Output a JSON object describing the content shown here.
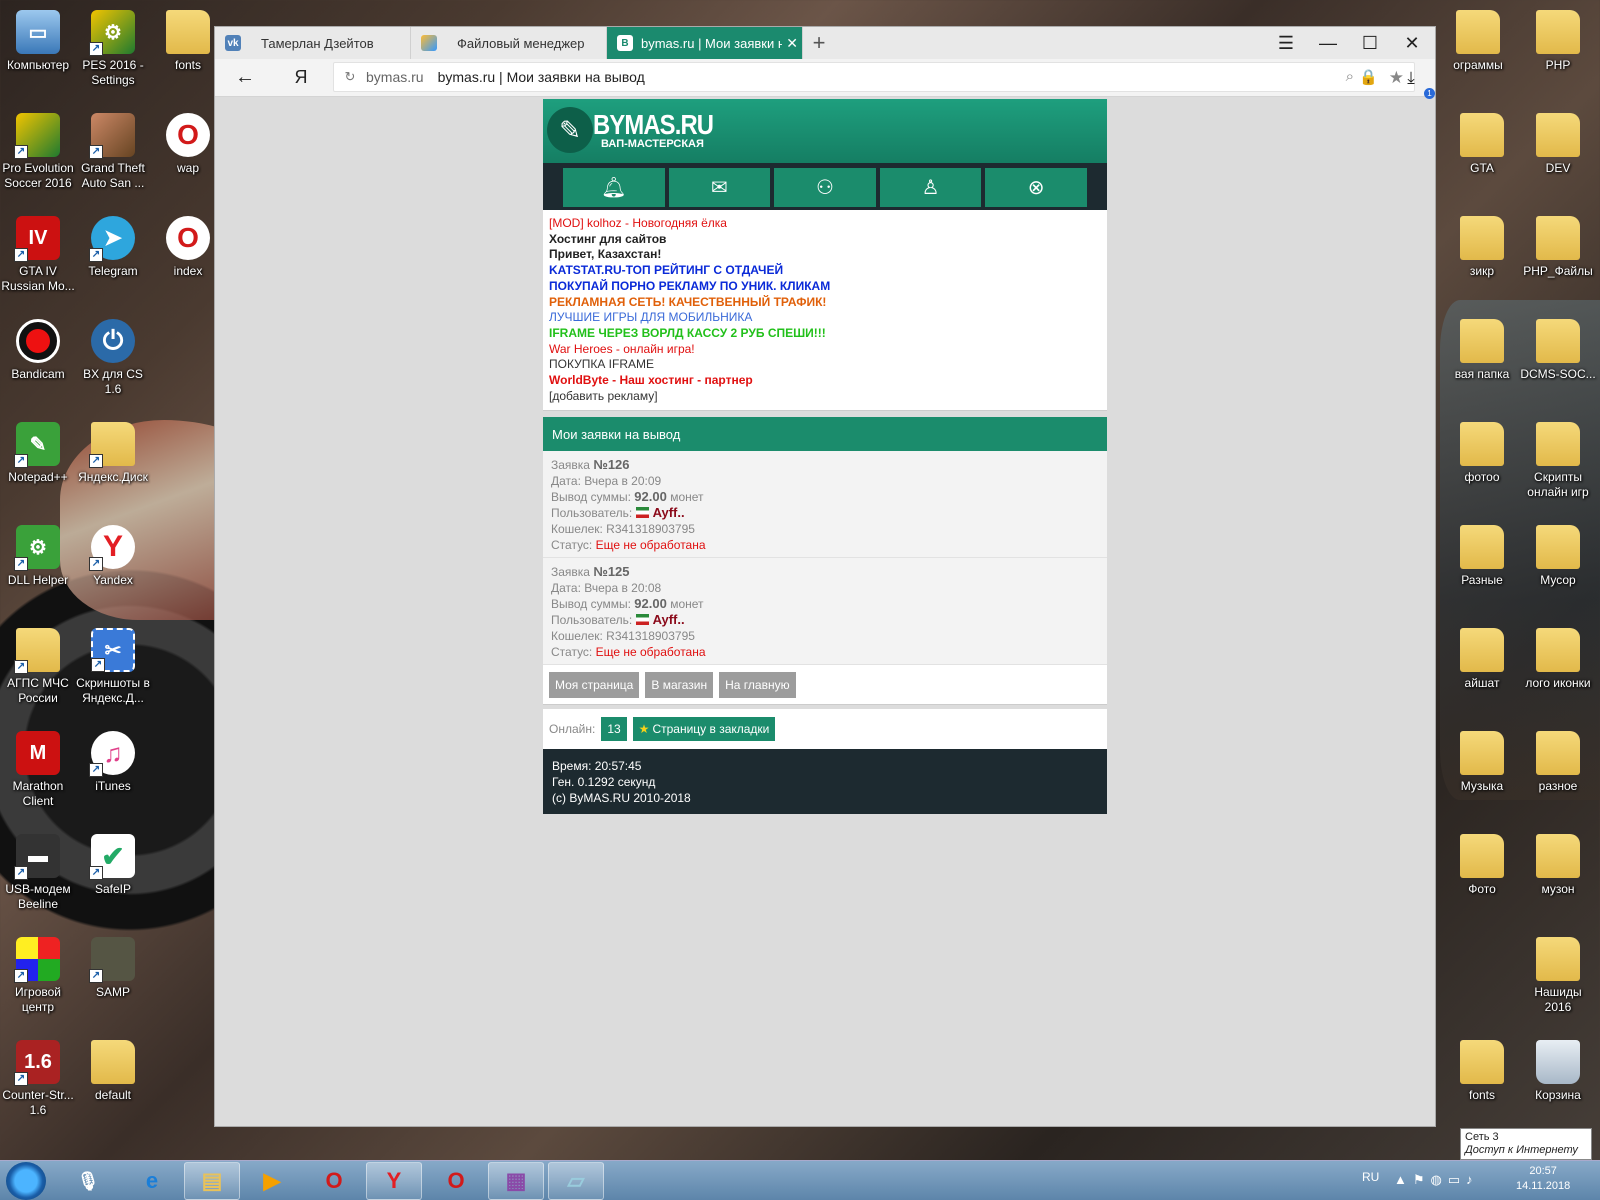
{
  "desktop": {
    "left_icons": [
      {
        "label": "Компьютер",
        "icon": "computer-icon"
      },
      {
        "label": "PES 2016 - Settings",
        "icon": "pes-settings-icon"
      },
      {
        "label": "fonts",
        "icon": "folder-icon"
      },
      {
        "label": "Pro Evolution Soccer 2016",
        "icon": "pes-icon"
      },
      {
        "label": "Grand Theft Auto San ...",
        "icon": "gta-icon"
      },
      {
        "label": "wap",
        "icon": "opera-icon"
      },
      {
        "label": "GTA IV Russian Mo...",
        "icon": "gta4-icon"
      },
      {
        "label": "Telegram",
        "icon": "telegram-icon"
      },
      {
        "label": "index",
        "icon": "opera-icon"
      },
      {
        "label": "Bandicam",
        "icon": "bandicam-icon"
      },
      {
        "label": "BX для CS 1.6",
        "icon": "power-icon"
      },
      {
        "label": "Notepad++",
        "icon": "notepad-icon"
      },
      {
        "label": "Яндекс.Диск",
        "icon": "yandex-disk-icon"
      },
      {
        "label": "DLL Helper",
        "icon": "gear-icon"
      },
      {
        "label": "Yandex",
        "icon": "yandex-icon"
      },
      {
        "label": "АГПС МЧС России",
        "icon": "folder-icon"
      },
      {
        "label": "Скриншоты в Яндекс.Д...",
        "icon": "screenshot-icon"
      },
      {
        "label": "Marathon Client",
        "icon": "marathon-icon"
      },
      {
        "label": "iTunes",
        "icon": "itunes-icon"
      },
      {
        "label": "USB-модем Beeline",
        "icon": "modem-icon"
      },
      {
        "label": "SafeIP",
        "icon": "safeip-icon"
      },
      {
        "label": "Игровой центр",
        "icon": "game-center-icon"
      },
      {
        "label": "SAMP",
        "icon": "samp-icon"
      },
      {
        "label": "Counter-Str... 1.6",
        "icon": "cs-icon"
      },
      {
        "label": "default",
        "icon": "folder-icon"
      }
    ],
    "right_icons": [
      {
        "label": "ограммы",
        "icon": "folder-icon"
      },
      {
        "label": "PHP",
        "icon": "folder-icon"
      },
      {
        "label": "GTA",
        "icon": "folder-icon"
      },
      {
        "label": "DEV",
        "icon": "folder-icon"
      },
      {
        "label": "зикр",
        "icon": "folder-icon"
      },
      {
        "label": "PHP_Файлы",
        "icon": "folder-icon"
      },
      {
        "label": "вая папка",
        "icon": "folder-icon"
      },
      {
        "label": "DCMS-SOC...",
        "icon": "folder-icon"
      },
      {
        "label": "фотоо",
        "icon": "folder-icon"
      },
      {
        "label": "Скрипты онлайн игр",
        "icon": "folder-icon"
      },
      {
        "label": "Разные",
        "icon": "folder-icon"
      },
      {
        "label": "Мусор",
        "icon": "folder-icon"
      },
      {
        "label": "айшат",
        "icon": "folder-icon"
      },
      {
        "label": "лого иконки",
        "icon": "folder-icon"
      },
      {
        "label": "Музыка",
        "icon": "folder-icon"
      },
      {
        "label": "разное",
        "icon": "folder-icon"
      },
      {
        "label": "Фото",
        "icon": "folder-icon"
      },
      {
        "label": "музон",
        "icon": "folder-icon"
      },
      {
        "label": "Нашиды 2016",
        "icon": "folder-icon"
      },
      {
        "label": "fonts",
        "icon": "folder-icon"
      },
      {
        "label": "Корзина",
        "icon": "recycle-bin-icon"
      }
    ]
  },
  "browser": {
    "tabs": [
      {
        "label": "Тамерлан Дзейтов",
        "favicon": "vk-icon"
      },
      {
        "label": "Файловый менеджер",
        "favicon": "file-manager-icon"
      },
      {
        "label": "bymas.ru | Мои заявки на вывод",
        "favicon": "B"
      }
    ],
    "address": {
      "domain": "bymas.ru",
      "title": "bymas.ru | Мои заявки на вывод"
    },
    "download_badge": "1",
    "yandex_button": "Я"
  },
  "site": {
    "logo_title": "BYMAS.RU",
    "logo_subtitle": "ВАП-МАСТЕРСКАЯ",
    "nav_icons": [
      "bell-icon",
      "mail-icon",
      "users-icon",
      "user-icon",
      "close-circle-icon"
    ],
    "ads": [
      {
        "text": "[MOD] kolhoz - Новогодняя ёлка",
        "color": "#e01010",
        "bold": false
      },
      {
        "text": "Хостинг для сайтов",
        "color": "#222222",
        "bold": true
      },
      {
        "text": "Привет, Казахстан!",
        "color": "#222222",
        "bold": true
      },
      {
        "text": "KATSTAT.RU-ТОП РЕЙТИНГ С ОТДАЧЕЙ",
        "color": "#0a2ad8",
        "bold": true
      },
      {
        "text": "ПОКУПАЙ ПОРНО РЕКЛАМУ ПО УНИК. КЛИКАМ",
        "color": "#0a2ad8",
        "bold": true
      },
      {
        "text": "РЕКЛАМНАЯ СЕТЬ! КАЧЕСТВЕННЫЙ ТРАФИК!",
        "color": "#e0600a",
        "bold": true
      },
      {
        "text": "ЛУЧШИЕ ИГРЫ ДЛЯ МОБИЛЬНИКА",
        "color": "#3a6ad8",
        "bold": false
      },
      {
        "text": "IFRAME ЧЕРЕЗ ВОРЛД КАССУ 2 РУБ СПЕШИ!!!",
        "color": "#22c01a",
        "bold": true
      },
      {
        "text": "War Heroes - онлайн игра!",
        "color": "#e01010",
        "bold": false
      },
      {
        "text": "ПОКУПКА IFRAME",
        "color": "#333333",
        "bold": false
      },
      {
        "text": "WorldByte - Наш хостинг - партнер",
        "color": "#e01010",
        "bold": true
      },
      {
        "text": "[добавить рекламу]",
        "color": "#333333",
        "bold": false
      }
    ],
    "panel_title": "Мои заявки на вывод",
    "labels": {
      "request": "Заявка",
      "date": "Дата:",
      "amount": "Вывод суммы:",
      "coins": "монет",
      "user": "Пользователь:",
      "wallet": "Кошелек:",
      "status": "Статус:"
    },
    "requests": [
      {
        "number": "№126",
        "date": "Вчера в 20:09",
        "amount": "92.00",
        "user": "Ayff..",
        "wallet": "R341318903795",
        "status": "Еще не обработана"
      },
      {
        "number": "№125",
        "date": "Вчера в 20:08",
        "amount": "92.00",
        "user": "Ayff..",
        "wallet": "R341318903795",
        "status": "Еще не обработана"
      }
    ],
    "links": [
      "Моя страница",
      "В магазин",
      "На главную"
    ],
    "online_label": "Онлайн:",
    "online_count": "13",
    "bookmark_label": "Страницу в закладки",
    "footer": {
      "time": "Время: 20:57:45",
      "gen": "Ген. 0.1292 секунд",
      "copyright": "(c) ByMAS.RU 2010-2018"
    },
    "colors": {
      "accent": "#1b8c6c",
      "dark": "#1d2a30"
    }
  },
  "taskbar": {
    "lang": "RU",
    "time": "20:57",
    "date": "14.11.2018",
    "network_tip_title": "Сеть 3",
    "network_tip_sub": "Доступ к Интернету"
  }
}
